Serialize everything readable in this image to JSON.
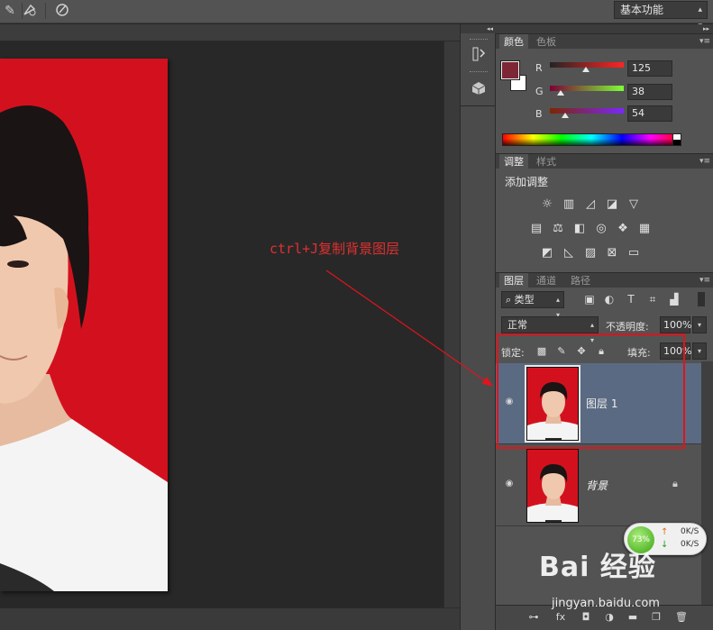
{
  "workspace": {
    "label": "基本功能"
  },
  "color_panel": {
    "tabs": [
      "颜色",
      "色板"
    ],
    "foreground_color": "#7d2636",
    "background_color": "#ffffff",
    "channels": [
      {
        "label": "R",
        "value": "125",
        "level": 0.49
      },
      {
        "label": "G",
        "value": "38",
        "level": 0.15
      },
      {
        "label": "B",
        "value": "54",
        "level": 0.21
      }
    ]
  },
  "adjustments_panel": {
    "tabs": [
      "调整",
      "样式"
    ],
    "title": "添加调整",
    "icons": [
      "brightness-icon",
      "levels-icon",
      "curves-icon",
      "exposure-icon",
      "vibrance-icon",
      "hue-saturation-icon",
      "color-balance-icon",
      "black-white-icon",
      "photo-filter-icon",
      "channel-mixer-icon",
      "color-lookup-icon",
      "invert-icon",
      "posterize-icon",
      "threshold-icon",
      "selective-color-icon",
      "gradient-map-icon"
    ]
  },
  "layers_panel": {
    "tabs": [
      "图层",
      "通道",
      "路径"
    ],
    "filter_label": "类型",
    "blend_mode": "正常",
    "opacity_label": "不透明度:",
    "opacity_value": "100%",
    "lock_label": "锁定:",
    "fill_label": "填充:",
    "fill_value": "100%",
    "layers": [
      {
        "name": "图层 1",
        "selected": true,
        "locked": false
      },
      {
        "name": "背景",
        "selected": false,
        "locked": true
      }
    ]
  },
  "annotation": {
    "text": "ctrl+J复制背景图层"
  },
  "speed_widget": {
    "percent": "73%",
    "upload": "0K/S",
    "download": "0K/S"
  },
  "watermark": {
    "logo": "Bai 经验",
    "site": "jingyan.baidu.com"
  },
  "colors": {
    "photo_background": "#d3111e",
    "selected_layer": "#5a6a82",
    "annotation": "#e0141c"
  }
}
